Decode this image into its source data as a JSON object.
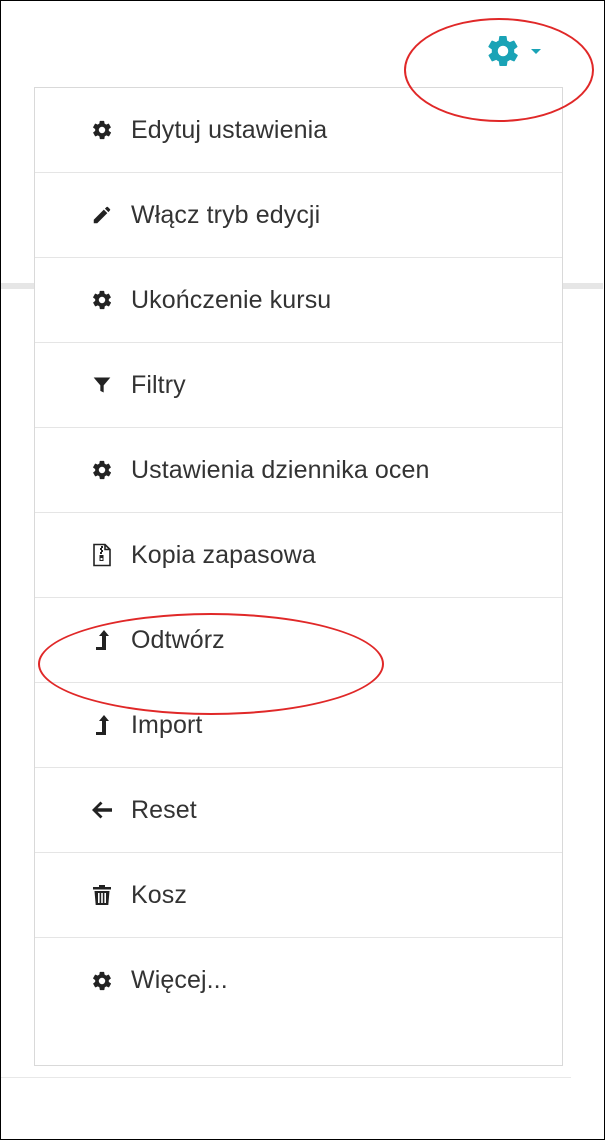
{
  "menu": {
    "items": [
      {
        "label": "Edytuj ustawienia",
        "icon": "gear-icon"
      },
      {
        "label": "Włącz tryb edycji",
        "icon": "pencil-icon"
      },
      {
        "label": "Ukończenie kursu",
        "icon": "gear-icon"
      },
      {
        "label": "Filtry",
        "icon": "filter-icon"
      },
      {
        "label": "Ustawienia dziennika ocen",
        "icon": "gear-icon"
      },
      {
        "label": "Kopia zapasowa",
        "icon": "archive-file-icon"
      },
      {
        "label": "Odtwórz",
        "icon": "upload-arrow-icon"
      },
      {
        "label": "Import",
        "icon": "upload-arrow-icon"
      },
      {
        "label": "Reset",
        "icon": "arrow-left-icon"
      },
      {
        "label": "Kosz",
        "icon": "trash-icon"
      },
      {
        "label": "Więcej...",
        "icon": "gear-icon"
      }
    ]
  },
  "colors": {
    "gear_trigger": "#1aa3b6",
    "highlight": "#e02828",
    "text": "#333333"
  }
}
